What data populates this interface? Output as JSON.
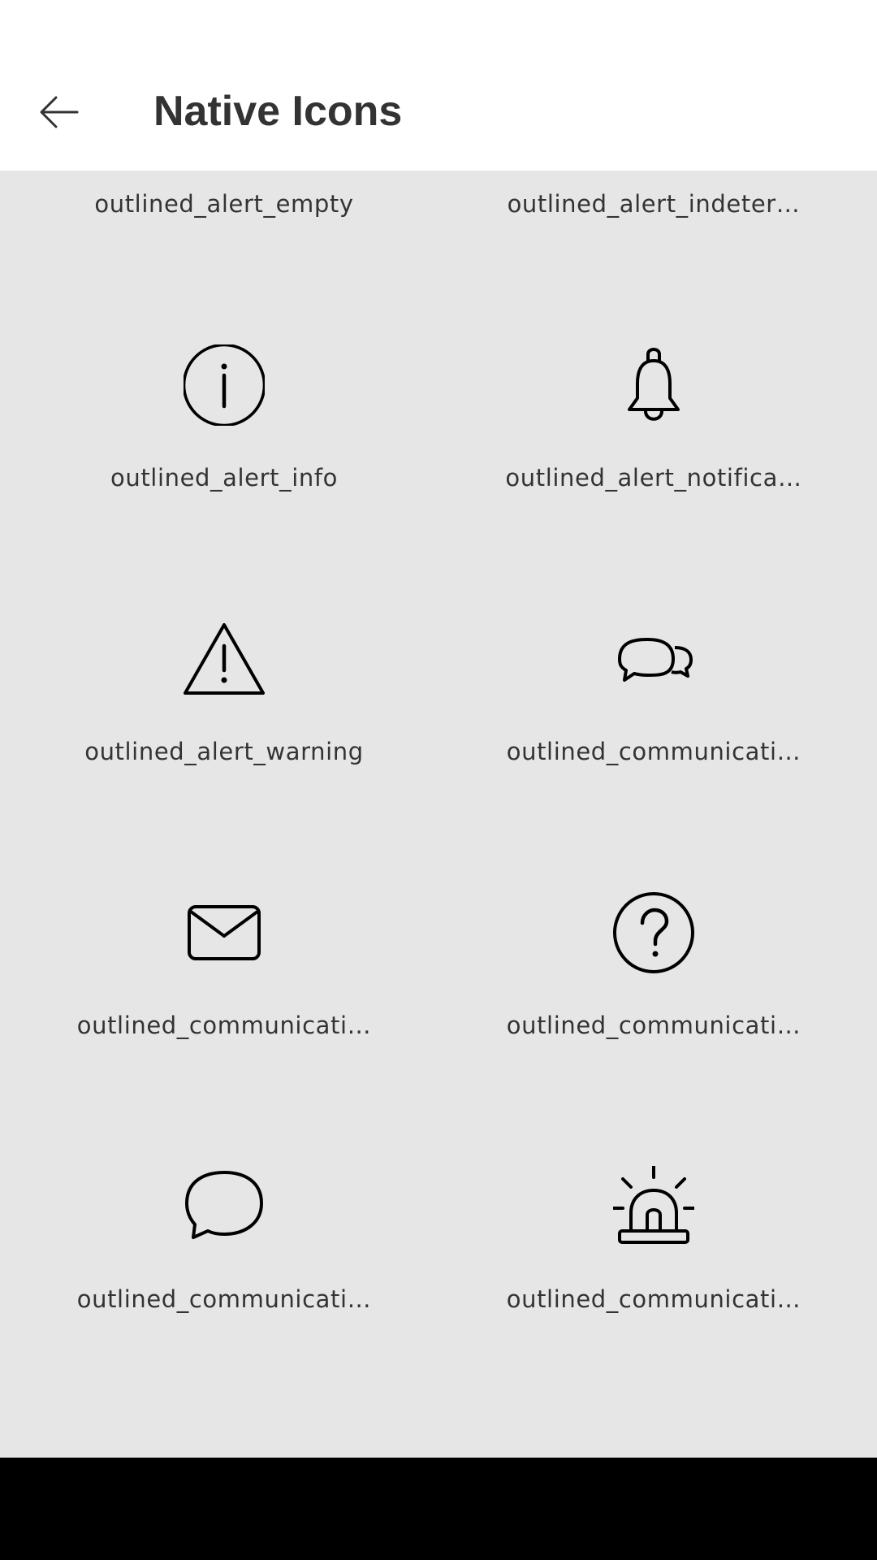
{
  "header": {
    "title": "Native Icons",
    "back_icon": "arrow-left-icon"
  },
  "grid": {
    "items": [
      {
        "label": "outlined_alert_empty",
        "icon": "circle-empty-icon"
      },
      {
        "label": "outlined_alert_indeter…",
        "icon": "circle-indeterminate-icon"
      },
      {
        "label": "outlined_alert_info",
        "icon": "info-circle-icon"
      },
      {
        "label": "outlined_alert_notifica…",
        "icon": "bell-icon"
      },
      {
        "label": "outlined_alert_warning",
        "icon": "warning-triangle-icon"
      },
      {
        "label": "outlined_communicati…",
        "icon": "chat-bubbles-icon"
      },
      {
        "label": "outlined_communicati…",
        "icon": "envelope-icon"
      },
      {
        "label": "outlined_communicati…",
        "icon": "help-circle-icon"
      },
      {
        "label": "outlined_communicati…",
        "icon": "speech-bubble-icon"
      },
      {
        "label": "outlined_communicati…",
        "icon": "siren-icon"
      }
    ]
  },
  "colors": {
    "header_bg": "#ffffff",
    "content_bg": "#e6e6e6",
    "nav_bar_bg": "#000000",
    "text": "#333333",
    "icon_stroke": "#000000"
  }
}
